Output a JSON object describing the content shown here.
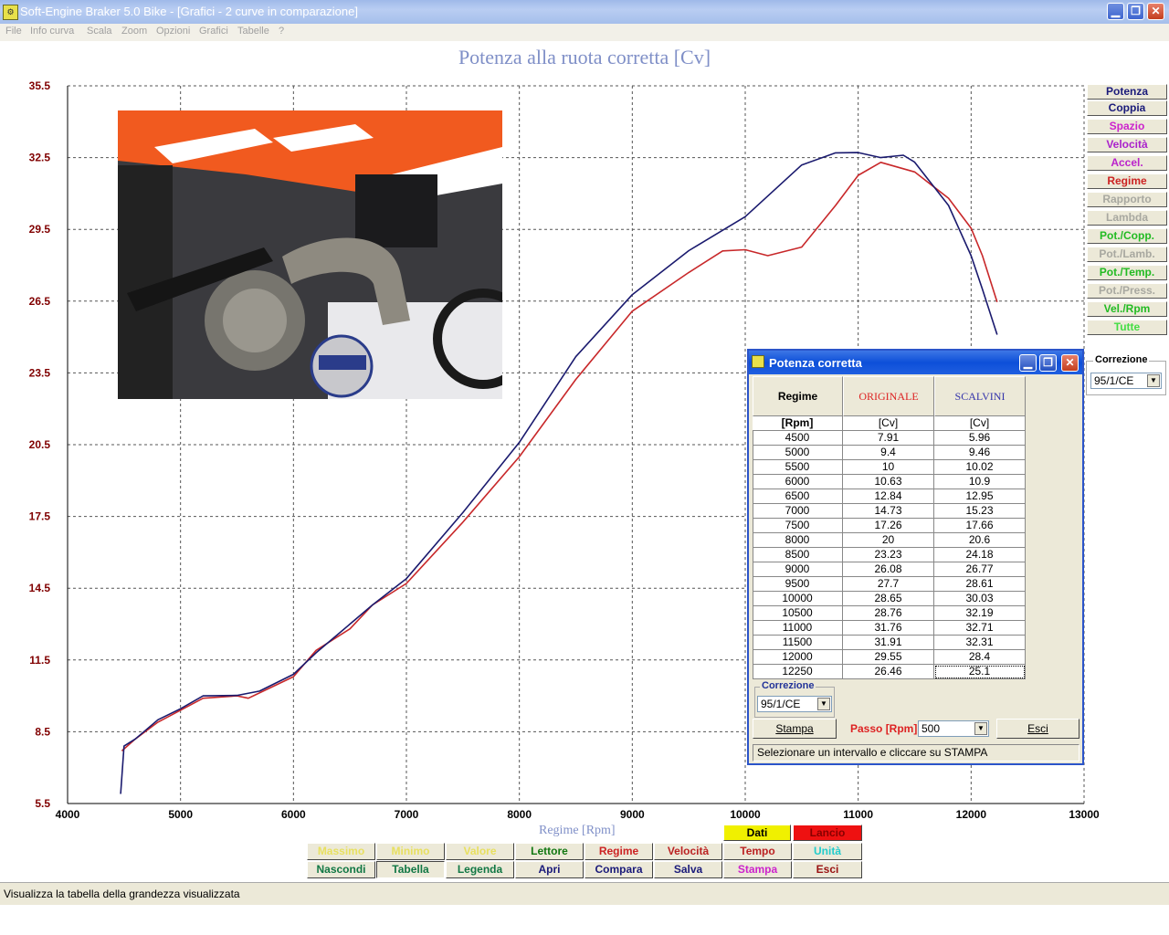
{
  "window": {
    "title": "Soft-Engine Braker 5.0 Bike - [Grafici - 2 curve in comparazione]",
    "minimize": "▁",
    "maximize": "❐",
    "close": "✕"
  },
  "menu": [
    "File",
    "Info curva",
    "Scala",
    "Zoom",
    "Opzioni",
    "Grafici",
    "Tabelle",
    "?"
  ],
  "chart_data": {
    "type": "line",
    "title": "Potenza alla ruota corretta [Cv]",
    "xlabel": "Regime [Rpm]",
    "ylabel": "",
    "xlim": [
      4000,
      13000
    ],
    "ylim": [
      5.5,
      35.5
    ],
    "xticks": [
      "4000",
      "5000",
      "6000",
      "7000",
      "8000",
      "9000",
      "10000",
      "11000",
      "12000",
      "13000"
    ],
    "yticks": [
      "5.5",
      "8.5",
      "11.5",
      "14.5",
      "17.5",
      "20.5",
      "23.5",
      "26.5",
      "29.5",
      "32.5",
      "35.5"
    ],
    "grid": true,
    "series": [
      {
        "name": "ORIGINALE",
        "color": "#c8282a",
        "x": [
          4480,
          4600,
          4800,
          5000,
          5200,
          5500,
          5600,
          6000,
          6200,
          6500,
          6700,
          7000,
          7500,
          8000,
          8500,
          9000,
          9500,
          9800,
          10000,
          10200,
          10500,
          10800,
          11000,
          11200,
          11500,
          11800,
          12000,
          12100,
          12230
        ],
        "y": [
          7.7,
          8.2,
          8.9,
          9.4,
          9.9,
          10.0,
          9.9,
          10.8,
          11.9,
          12.8,
          13.8,
          14.7,
          17.26,
          20.0,
          23.23,
          26.08,
          27.7,
          28.6,
          28.65,
          28.4,
          28.76,
          30.5,
          31.76,
          32.3,
          31.9,
          30.8,
          29.55,
          28.4,
          26.46
        ]
      },
      {
        "name": "SCALVINI",
        "color": "#1a1a6e",
        "x": [
          4470,
          4500,
          4600,
          4800,
          5000,
          5200,
          5500,
          5700,
          6000,
          6200,
          6400,
          6700,
          7000,
          7500,
          8000,
          8500,
          9000,
          9500,
          10000,
          10500,
          10800,
          11000,
          11200,
          11400,
          11500,
          11800,
          12000,
          12100,
          12230
        ],
        "y": [
          5.9,
          7.9,
          8.2,
          9.0,
          9.46,
          10.0,
          10.02,
          10.2,
          10.9,
          11.8,
          12.6,
          13.8,
          14.9,
          17.66,
          20.6,
          24.18,
          26.77,
          28.61,
          30.03,
          32.19,
          32.7,
          32.71,
          32.5,
          32.6,
          32.31,
          30.5,
          28.4,
          27.0,
          25.1
        ]
      }
    ]
  },
  "right_buttons": [
    {
      "label": "Potenza",
      "color": "#1a1a7a"
    },
    {
      "label": "Coppia",
      "color": "#1a1a7a"
    },
    {
      "label": "Spazio",
      "color": "#cc22cc"
    },
    {
      "label": "Velocità",
      "color": "#aa22cc"
    },
    {
      "label": "Accel.",
      "color": "#bb22cc"
    },
    {
      "label": "Regime",
      "color": "#cc2222"
    },
    {
      "label": "Rapporto",
      "color": "#a8a8a0"
    },
    {
      "label": "Lambda",
      "color": "#a8a8a0"
    },
    {
      "label": "Pot./Copp.",
      "color": "#22bb22"
    },
    {
      "label": "Pot./Lamb.",
      "color": "#a8a8a0"
    },
    {
      "label": "Pot./Temp.",
      "color": "#22bb22"
    },
    {
      "label": "Pot./Press.",
      "color": "#a8a8a0"
    },
    {
      "label": "Vel./Rpm",
      "color": "#22bb22"
    },
    {
      "label": "Tutte",
      "color": "#44dd44"
    }
  ],
  "correzione_panel": {
    "title": "Correzione",
    "value": "95/1/CE"
  },
  "bottom": {
    "row0": [
      {
        "label": "Dati",
        "color": "#000000",
        "bg": "#f0f000"
      },
      {
        "label": "Lancio",
        "color": "#880000",
        "bg": "#ee1111"
      }
    ],
    "row1": [
      {
        "label": "Massimo",
        "color": "#e8e060"
      },
      {
        "label": "Minimo",
        "color": "#e8e060"
      },
      {
        "label": "Valore medio",
        "color": "#e8e060"
      },
      {
        "label": "Lettore",
        "color": "#117711"
      },
      {
        "label": "Regime",
        "color": "#cc2222"
      },
      {
        "label": "Velocità",
        "color": "#bb2222"
      },
      {
        "label": "Tempo",
        "color": "#bb2222"
      },
      {
        "label": "Unità",
        "color": "#22cccc"
      }
    ],
    "row2": [
      {
        "label": "Nascondi",
        "color": "#117744"
      },
      {
        "label": "Tabella",
        "color": "#117744"
      },
      {
        "label": "Legenda",
        "color": "#117744"
      },
      {
        "label": "Apri",
        "color": "#1a1a7a"
      },
      {
        "label": "Compara",
        "color": "#1a1a7a"
      },
      {
        "label": "Salva",
        "color": "#1a1a7a"
      },
      {
        "label": "Stampa",
        "color": "#cc22cc"
      },
      {
        "label": "Esci",
        "color": "#991111"
      }
    ]
  },
  "status": "Visualizza la tabella della grandezza visualizzata",
  "dialog": {
    "title": "Potenza corretta",
    "header": {
      "col0": "Regime",
      "col1": "ORIGINALE",
      "col2": "SCALVINI",
      "units": [
        "[Rpm]",
        "[Cv]",
        "[Cv]"
      ]
    },
    "rows": [
      [
        "4500",
        "7.91",
        "5.96"
      ],
      [
        "5000",
        "9.4",
        "9.46"
      ],
      [
        "5500",
        "10",
        "10.02"
      ],
      [
        "6000",
        "10.63",
        "10.9"
      ],
      [
        "6500",
        "12.84",
        "12.95"
      ],
      [
        "7000",
        "14.73",
        "15.23"
      ],
      [
        "7500",
        "17.26",
        "17.66"
      ],
      [
        "8000",
        "20",
        "20.6"
      ],
      [
        "8500",
        "23.23",
        "24.18"
      ],
      [
        "9000",
        "26.08",
        "26.77"
      ],
      [
        "9500",
        "27.7",
        "28.61"
      ],
      [
        "10000",
        "28.65",
        "30.03"
      ],
      [
        "10500",
        "28.76",
        "32.19"
      ],
      [
        "11000",
        "31.76",
        "32.71"
      ],
      [
        "11500",
        "31.91",
        "32.31"
      ],
      [
        "12000",
        "29.55",
        "28.4"
      ],
      [
        "12250",
        "26.46",
        "25.1"
      ]
    ],
    "correzione_title": "Correzione",
    "correzione_value": "95/1/CE",
    "stampa": "Stampa",
    "passo_label": "Passo [Rpm]",
    "passo_value": "500",
    "esci": "Esci",
    "hint": "Selezionare un intervallo e cliccare su STAMPA"
  }
}
